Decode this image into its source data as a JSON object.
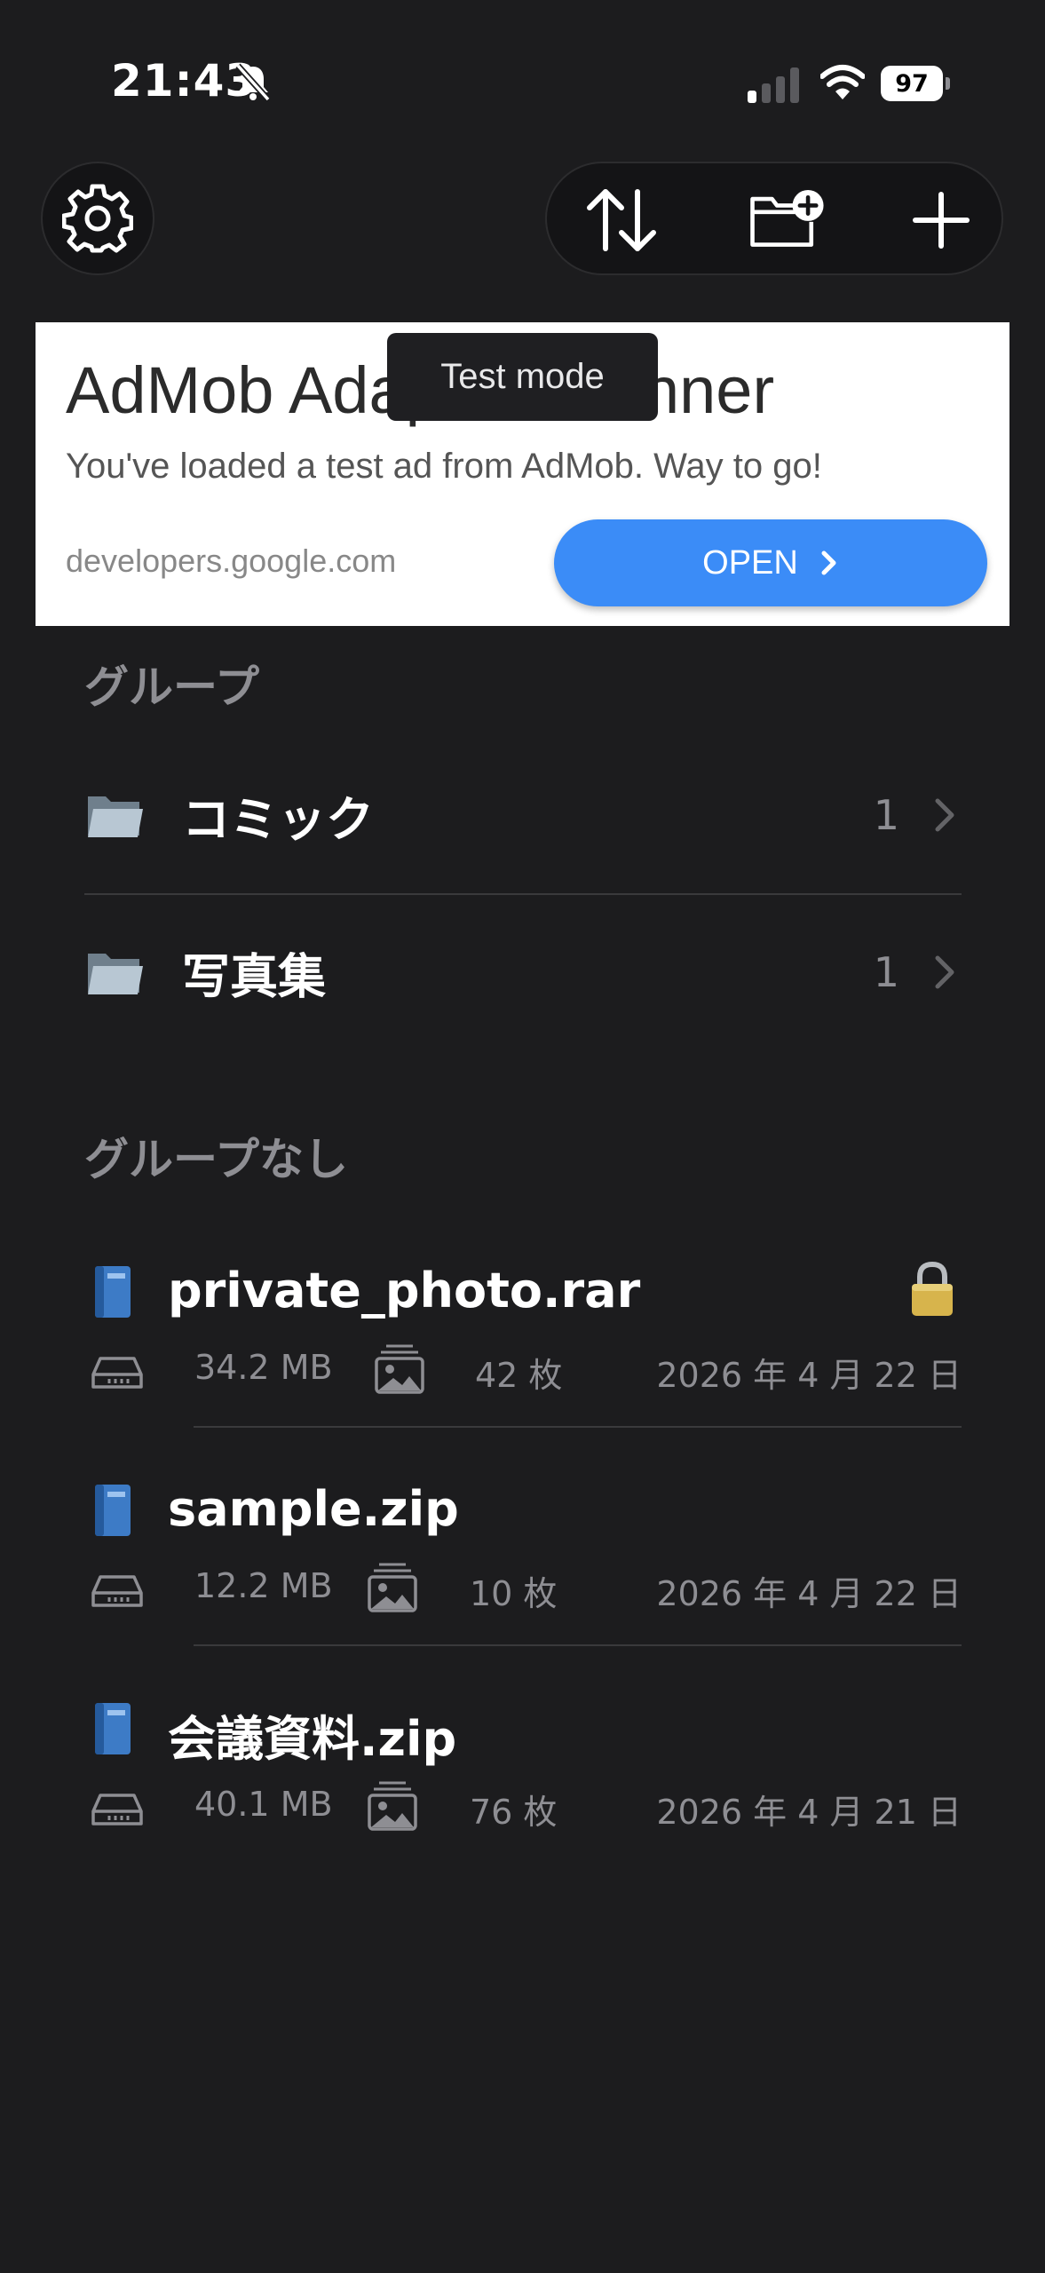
{
  "status_bar": {
    "time": "21:43",
    "battery": "97",
    "icons": [
      "bell-slash-icon",
      "cellular-signal-icon",
      "wifi-icon",
      "battery-icon"
    ]
  },
  "toolbar": {
    "icons": [
      "gear-icon",
      "sort-arrows-icon",
      "new-folder-icon",
      "plus-icon"
    ]
  },
  "ad": {
    "headline": "AdMob Adaptive Banner",
    "body": "You've loaded a test ad from AdMob. Way to go!",
    "url": "developers.google.com",
    "open_label": "OPEN",
    "test_mode_label": "Test mode"
  },
  "groups_section": {
    "title": "グループ",
    "items": [
      {
        "name": "コミック",
        "count": "1"
      },
      {
        "name": "写真集",
        "count": "1"
      }
    ]
  },
  "ungrouped_section": {
    "title": "グループなし",
    "files": [
      {
        "name": "private_photo.rar",
        "size": "34.2 MB",
        "pages": "42 枚",
        "date": "2026 年 4 月 22 日",
        "locked": true
      },
      {
        "name": "sample.zip",
        "size": "12.2 MB",
        "pages": "10 枚",
        "date": "2026 年 4 月 22 日",
        "locked": false
      },
      {
        "name": "会議資料.zip",
        "size": "40.1 MB",
        "pages": "76 枚",
        "date": "2026 年 4 月 21 日",
        "locked": false
      }
    ]
  },
  "colors": {
    "background": "#1c1c1e",
    "secondary_text": "#8e8e93",
    "ad_button": "#3b8cf7"
  }
}
